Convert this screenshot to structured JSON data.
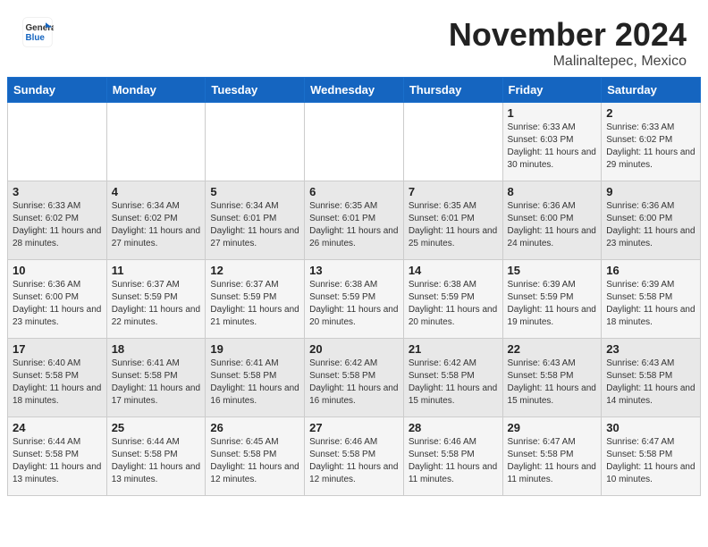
{
  "header": {
    "logo_general": "General",
    "logo_blue": "Blue",
    "month_title": "November 2024",
    "location": "Malinaltepec, Mexico"
  },
  "days_of_week": [
    "Sunday",
    "Monday",
    "Tuesday",
    "Wednesday",
    "Thursday",
    "Friday",
    "Saturday"
  ],
  "weeks": [
    [
      {
        "day": "",
        "info": ""
      },
      {
        "day": "",
        "info": ""
      },
      {
        "day": "",
        "info": ""
      },
      {
        "day": "",
        "info": ""
      },
      {
        "day": "",
        "info": ""
      },
      {
        "day": "1",
        "info": "Sunrise: 6:33 AM\nSunset: 6:03 PM\nDaylight: 11 hours\nand 30 minutes."
      },
      {
        "day": "2",
        "info": "Sunrise: 6:33 AM\nSunset: 6:02 PM\nDaylight: 11 hours\nand 29 minutes."
      }
    ],
    [
      {
        "day": "3",
        "info": "Sunrise: 6:33 AM\nSunset: 6:02 PM\nDaylight: 11 hours\nand 28 minutes."
      },
      {
        "day": "4",
        "info": "Sunrise: 6:34 AM\nSunset: 6:02 PM\nDaylight: 11 hours\nand 27 minutes."
      },
      {
        "day": "5",
        "info": "Sunrise: 6:34 AM\nSunset: 6:01 PM\nDaylight: 11 hours\nand 27 minutes."
      },
      {
        "day": "6",
        "info": "Sunrise: 6:35 AM\nSunset: 6:01 PM\nDaylight: 11 hours\nand 26 minutes."
      },
      {
        "day": "7",
        "info": "Sunrise: 6:35 AM\nSunset: 6:01 PM\nDaylight: 11 hours\nand 25 minutes."
      },
      {
        "day": "8",
        "info": "Sunrise: 6:36 AM\nSunset: 6:00 PM\nDaylight: 11 hours\nand 24 minutes."
      },
      {
        "day": "9",
        "info": "Sunrise: 6:36 AM\nSunset: 6:00 PM\nDaylight: 11 hours\nand 23 minutes."
      }
    ],
    [
      {
        "day": "10",
        "info": "Sunrise: 6:36 AM\nSunset: 6:00 PM\nDaylight: 11 hours\nand 23 minutes."
      },
      {
        "day": "11",
        "info": "Sunrise: 6:37 AM\nSunset: 5:59 PM\nDaylight: 11 hours\nand 22 minutes."
      },
      {
        "day": "12",
        "info": "Sunrise: 6:37 AM\nSunset: 5:59 PM\nDaylight: 11 hours\nand 21 minutes."
      },
      {
        "day": "13",
        "info": "Sunrise: 6:38 AM\nSunset: 5:59 PM\nDaylight: 11 hours\nand 20 minutes."
      },
      {
        "day": "14",
        "info": "Sunrise: 6:38 AM\nSunset: 5:59 PM\nDaylight: 11 hours\nand 20 minutes."
      },
      {
        "day": "15",
        "info": "Sunrise: 6:39 AM\nSunset: 5:59 PM\nDaylight: 11 hours\nand 19 minutes."
      },
      {
        "day": "16",
        "info": "Sunrise: 6:39 AM\nSunset: 5:58 PM\nDaylight: 11 hours\nand 18 minutes."
      }
    ],
    [
      {
        "day": "17",
        "info": "Sunrise: 6:40 AM\nSunset: 5:58 PM\nDaylight: 11 hours\nand 18 minutes."
      },
      {
        "day": "18",
        "info": "Sunrise: 6:41 AM\nSunset: 5:58 PM\nDaylight: 11 hours\nand 17 minutes."
      },
      {
        "day": "19",
        "info": "Sunrise: 6:41 AM\nSunset: 5:58 PM\nDaylight: 11 hours\nand 16 minutes."
      },
      {
        "day": "20",
        "info": "Sunrise: 6:42 AM\nSunset: 5:58 PM\nDaylight: 11 hours\nand 16 minutes."
      },
      {
        "day": "21",
        "info": "Sunrise: 6:42 AM\nSunset: 5:58 PM\nDaylight: 11 hours\nand 15 minutes."
      },
      {
        "day": "22",
        "info": "Sunrise: 6:43 AM\nSunset: 5:58 PM\nDaylight: 11 hours\nand 15 minutes."
      },
      {
        "day": "23",
        "info": "Sunrise: 6:43 AM\nSunset: 5:58 PM\nDaylight: 11 hours\nand 14 minutes."
      }
    ],
    [
      {
        "day": "24",
        "info": "Sunrise: 6:44 AM\nSunset: 5:58 PM\nDaylight: 11 hours\nand 13 minutes."
      },
      {
        "day": "25",
        "info": "Sunrise: 6:44 AM\nSunset: 5:58 PM\nDaylight: 11 hours\nand 13 minutes."
      },
      {
        "day": "26",
        "info": "Sunrise: 6:45 AM\nSunset: 5:58 PM\nDaylight: 11 hours\nand 12 minutes."
      },
      {
        "day": "27",
        "info": "Sunrise: 6:46 AM\nSunset: 5:58 PM\nDaylight: 11 hours\nand 12 minutes."
      },
      {
        "day": "28",
        "info": "Sunrise: 6:46 AM\nSunset: 5:58 PM\nDaylight: 11 hours\nand 11 minutes."
      },
      {
        "day": "29",
        "info": "Sunrise: 6:47 AM\nSunset: 5:58 PM\nDaylight: 11 hours\nand 11 minutes."
      },
      {
        "day": "30",
        "info": "Sunrise: 6:47 AM\nSunset: 5:58 PM\nDaylight: 11 hours\nand 10 minutes."
      }
    ]
  ]
}
